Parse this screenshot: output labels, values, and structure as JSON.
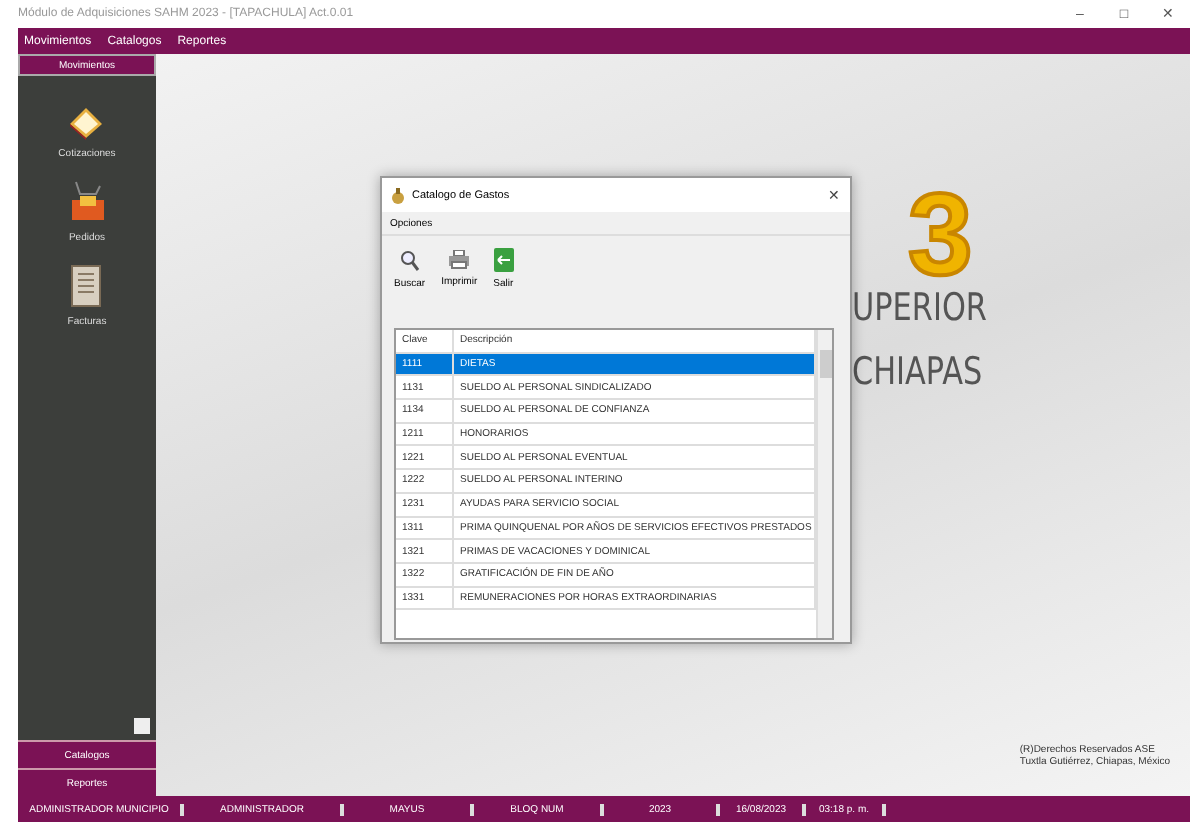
{
  "window": {
    "title": "Módulo de Adquisiciones SAHM 2023 - [TAPACHULA] Act.0.01",
    "controls": [
      "–",
      "□",
      "✕"
    ]
  },
  "menu": [
    "Movimientos",
    "Catalogos",
    "Reportes"
  ],
  "sidebar": {
    "header": "Movimientos",
    "items": [
      {
        "label": "Cotizaciones",
        "kind": "quote"
      },
      {
        "label": "Pedidos",
        "kind": "order"
      },
      {
        "label": "Facturas",
        "kind": "invoice"
      }
    ],
    "sections": [
      "Catalogos",
      "Reportes"
    ]
  },
  "background": {
    "lines": [
      "UPERIOR",
      "CHIAPAS"
    ],
    "badge": "3",
    "footer": [
      "(R)Derechos Reservados ASE",
      "Tuxtla Gutiérrez, Chiapas, México"
    ]
  },
  "dialog": {
    "title": "Catalogo de Gastos",
    "close": "✕",
    "menu": "Opciones",
    "tools": [
      {
        "label": "Buscar",
        "kind": "search"
      },
      {
        "label": "Imprimir",
        "kind": "print"
      },
      {
        "label": "Salir",
        "kind": "exit"
      }
    ],
    "columns": [
      "Clave",
      "Descripción"
    ],
    "rows": [
      {
        "clave": "1111",
        "descripcion": "DIETAS",
        "selected": true
      },
      {
        "clave": "1131",
        "descripcion": "SUELDO AL PERSONAL SINDICALIZADO",
        "selected": false
      },
      {
        "clave": "1134",
        "descripcion": "SUELDO AL PERSONAL DE CONFIANZA",
        "selected": false
      },
      {
        "clave": "1211",
        "descripcion": "HONORARIOS",
        "selected": false
      },
      {
        "clave": "1221",
        "descripcion": "SUELDO AL PERSONAL EVENTUAL",
        "selected": false
      },
      {
        "clave": "1222",
        "descripcion": "SUELDO AL PERSONAL INTERINO",
        "selected": false
      },
      {
        "clave": "1231",
        "descripcion": "AYUDAS PARA SERVICIO SOCIAL",
        "selected": false
      },
      {
        "clave": "1311",
        "descripcion": "PRIMA QUINQUENAL POR AÑOS DE SERVICIOS EFECTIVOS PRESTADOS",
        "selected": false
      },
      {
        "clave": "1321",
        "descripcion": "PRIMAS DE VACACIONES Y DOMINICAL",
        "selected": false
      },
      {
        "clave": "1322",
        "descripcion": "GRATIFICACIÓN DE FIN DE AÑO",
        "selected": false
      },
      {
        "clave": "1331",
        "descripcion": "REMUNERACIONES POR HORAS EXTRAORDINARIAS",
        "selected": false
      }
    ]
  },
  "status_bar": [
    "ADMINISTRADOR MUNICIPIO",
    "ADMINISTRADOR",
    "MAYUS",
    "BLOQ NUM",
    "2023",
    "16/08/2023",
    "03:18 p. m."
  ]
}
